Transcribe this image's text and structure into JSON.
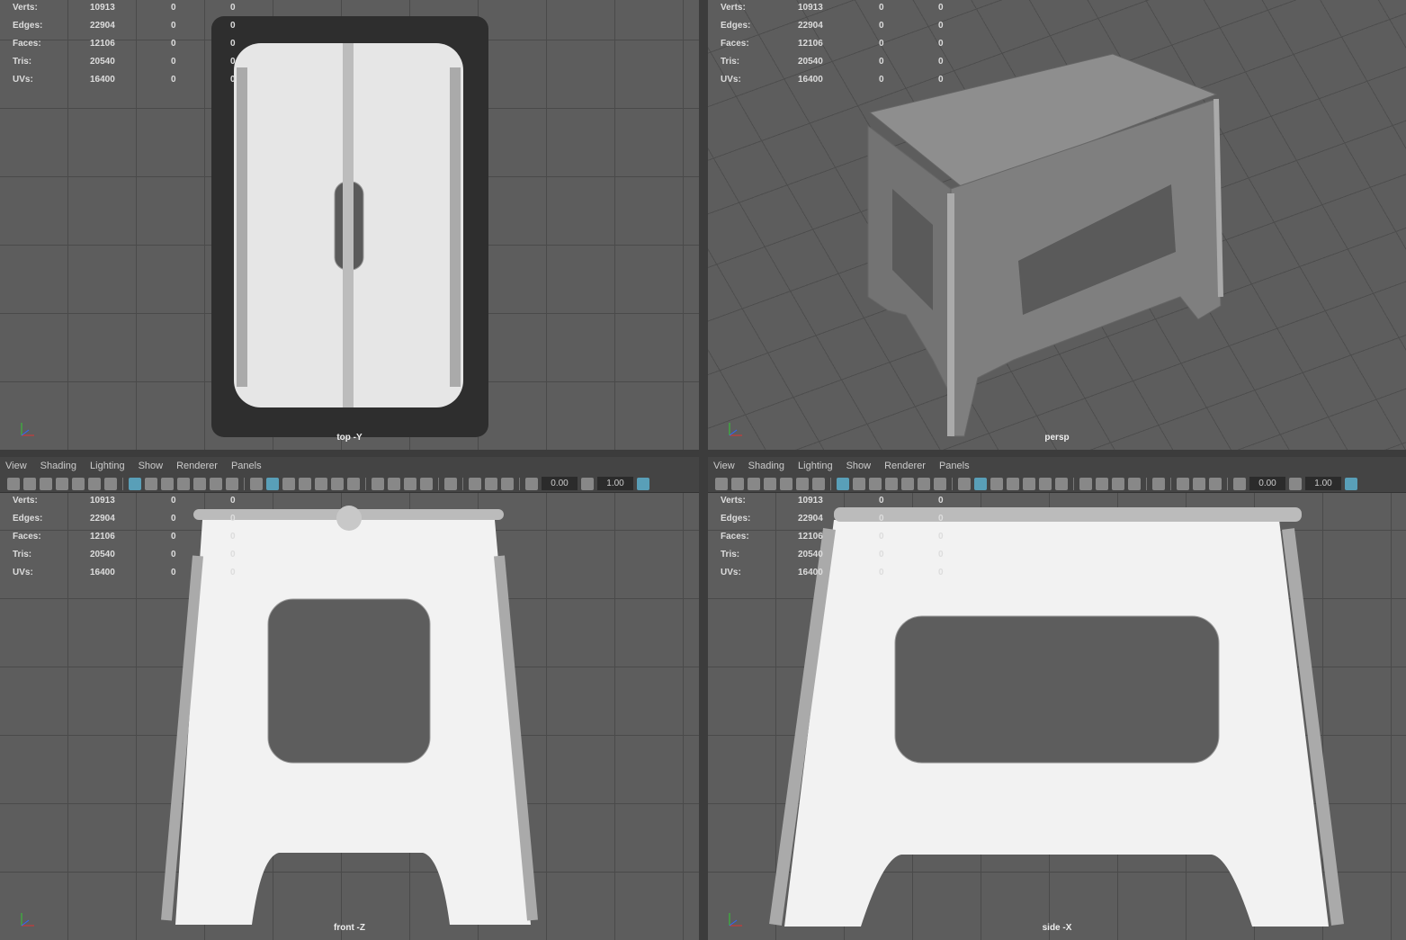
{
  "menus": [
    "View",
    "Shading",
    "Lighting",
    "Show",
    "Renderer",
    "Panels"
  ],
  "toolbar": {
    "field1": "0.00",
    "field2": "1.00"
  },
  "stats": [
    {
      "label": "Verts:",
      "value": "10913",
      "sel": "0",
      "uv": "0"
    },
    {
      "label": "Edges:",
      "value": "22904",
      "sel": "0",
      "uv": "0"
    },
    {
      "label": "Faces:",
      "value": "12106",
      "sel": "0",
      "uv": "0"
    },
    {
      "label": "Tris:",
      "value": "20540",
      "sel": "0",
      "uv": "0"
    },
    {
      "label": "UVs:",
      "value": "16400",
      "sel": "0",
      "uv": "0"
    }
  ],
  "viewports": {
    "top": "top -Y",
    "persp": "persp",
    "front": "front -Z",
    "side": "side -X"
  },
  "colors": {
    "accent": "#5fb7d6",
    "viewport_bg": "#5d5d5d"
  }
}
